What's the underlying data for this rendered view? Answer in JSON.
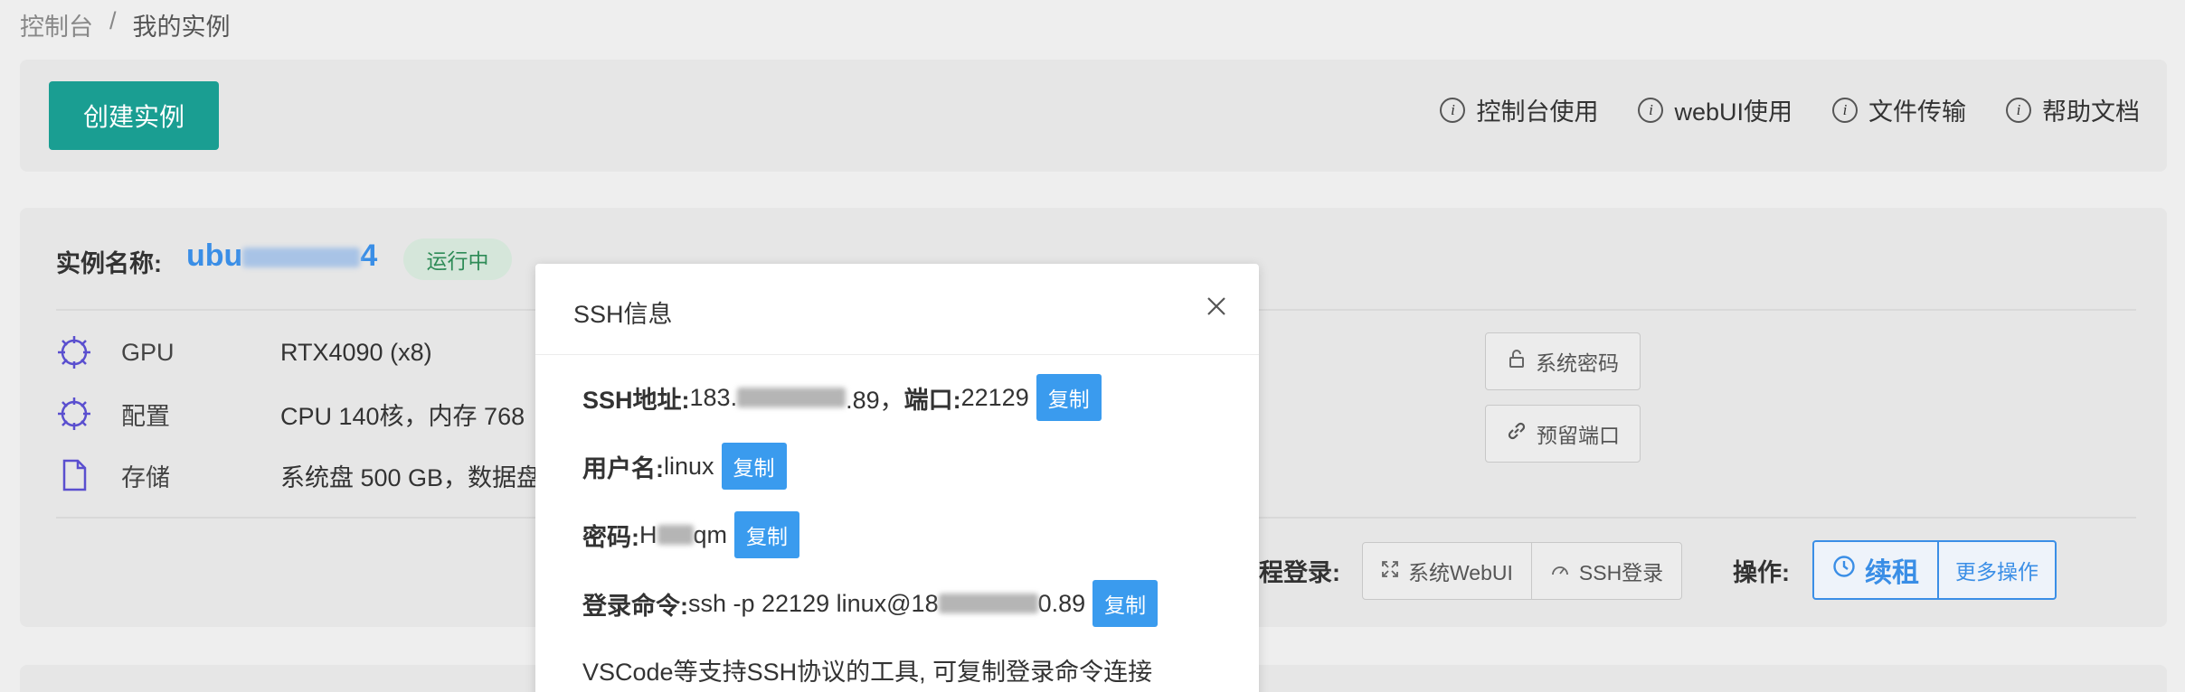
{
  "breadcrumb": {
    "root": "控制台",
    "separator": "/",
    "current": "我的实例"
  },
  "toolbar": {
    "create_label": "创建实例",
    "help_links": [
      {
        "label": "控制台使用",
        "icon": "info-icon"
      },
      {
        "label": "webUI使用",
        "icon": "info-icon"
      },
      {
        "label": "文件传输",
        "icon": "info-icon"
      },
      {
        "label": "帮助文档",
        "icon": "info-icon"
      }
    ]
  },
  "instance": {
    "name_label": "实例名称:",
    "name_prefix": "ubu",
    "name_suffix": "4",
    "status": "运行中",
    "specs": [
      {
        "name": "GPU",
        "value": "RTX4090 (x8)",
        "icon": "chip-icon"
      },
      {
        "name": "配置",
        "value": "CPU 140核，内存 768",
        "icon": "chip-icon"
      },
      {
        "name": "存储",
        "value": "系统盘 500 GB，数据盘",
        "icon": "file-icon"
      }
    ],
    "side_buttons": {
      "password": "系统密码",
      "reserved_port": "预留端口"
    },
    "remote_label": "程登录:",
    "remote_buttons": {
      "webui": "系统WebUI",
      "ssh": "SSH登录"
    },
    "ops_label": "操作:",
    "renew": "续租",
    "more": "更多操作"
  },
  "modal": {
    "title": "SSH信息",
    "address_label": "SSH地址:",
    "address_prefix": "183.",
    "address_suffix": ".89，",
    "port_label": "端口:",
    "port_value": "22129",
    "username_label": "用户名:",
    "username_value": "linux",
    "password_label": "密码:",
    "password_prefix": "H",
    "password_suffix": "qm",
    "command_label": "登录命令:",
    "command_prefix": "ssh -p 22129 linux@18",
    "command_suffix": "0.89",
    "copy_label": "复制",
    "note": "VSCode等支持SSH协议的工具, 可复制登录命令连接"
  },
  "colors": {
    "accent": "#1a9e92",
    "link_blue": "#3a8ee6",
    "copy_blue": "#3a9bee",
    "status_green": "#2e8b57"
  }
}
